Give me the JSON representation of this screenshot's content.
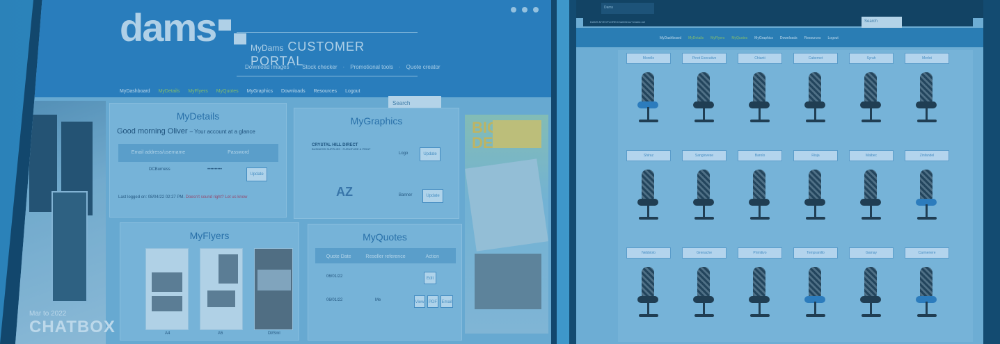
{
  "left_portal": {
    "brand": "dams",
    "portal_title_prefix": "MyDams",
    "portal_title_main": "CUSTOMER PORTAL",
    "portal_links": [
      "Download images",
      "Stock checker",
      "Promotional tools",
      "Quote creator"
    ],
    "nav": [
      "MyDashboard",
      "MyDetails",
      "MyFlyers",
      "MyQuotes",
      "MyGraphics",
      "Downloads",
      "Resources",
      "Logout"
    ],
    "search_placeholder": "Search",
    "mydetails": {
      "title": "MyDetails",
      "greeting": "Good morning Oliver",
      "greeting_suffix": "– Your account at a glance",
      "columns": [
        "Email address/username",
        "Password"
      ],
      "row_username": "DCBurness",
      "row_password": "••••••••••",
      "button": "Update",
      "last_login_prefix": "Last logged on: 08/04/22 02:27 PM.",
      "last_login_warning": "Doesn't sound right? Let us know"
    },
    "mygraphics": {
      "title": "MyGraphics",
      "company_name": "CRYSTAL HILL DIRECT",
      "company_subtitle": "BUSINESS SUPPLIES · FURNITURE & PRINT",
      "logo_label": "Logo",
      "logo_button": "Update",
      "banner_label": "Banner",
      "banner_button": "Update",
      "az_text": "AZ"
    },
    "myflyers": {
      "title": "MyFlyers",
      "thumb_labels": [
        "A4",
        "A5",
        "Dl/Sml"
      ]
    },
    "myquotes": {
      "title": "MyQuotes",
      "columns": [
        "Quote Date",
        "Reseller reference",
        "Action"
      ],
      "rows": [
        {
          "date": "06/01/22",
          "ref": "",
          "actions": [
            "Edit"
          ]
        },
        {
          "date": "06/01/22",
          "ref": "Me",
          "actions": [
            "View",
            "PDF",
            "Email"
          ]
        }
      ]
    },
    "side_banner": {
      "small": "Mar to 2022",
      "big": "CHATBOX"
    },
    "big_deals": {
      "headline": "BIG DEALS"
    }
  },
  "right_portal": {
    "browser_tab": "Dams",
    "address": "DAMS.MYEXPLORE/ChairMenu/?chairs=all",
    "nav": [
      "MyDashboard",
      "MyDetails",
      "MyFlyers",
      "MyQuotes",
      "MyGraphics",
      "Downloads",
      "Resources",
      "Logout"
    ],
    "search_placeholder": "Search",
    "rows": [
      {
        "labels": [
          "Morello",
          "Pinot Executive",
          "Chianti",
          "Cabernet",
          "Syrah",
          "Merlot"
        ],
        "seat_blue": [
          true,
          false,
          false,
          false,
          false,
          false
        ]
      },
      {
        "labels": [
          "Shiraz",
          "Sangiovese",
          "Barolo",
          "Rioja",
          "Malbec",
          "Zinfandel"
        ],
        "seat_blue": [
          false,
          false,
          false,
          false,
          false,
          true
        ]
      },
      {
        "labels": [
          "Nebbiolo",
          "Grenache",
          "Primitivo",
          "Tempranillo",
          "Gamay",
          "Carmenere"
        ],
        "seat_blue": [
          false,
          false,
          false,
          true,
          false,
          true
        ]
      }
    ]
  }
}
